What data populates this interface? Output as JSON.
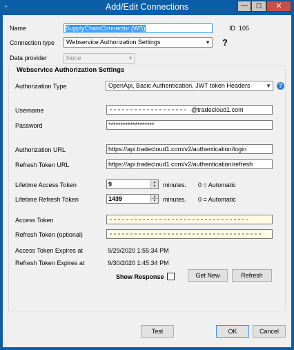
{
  "window": {
    "title": "Add/Edit Connections",
    "buttons": {
      "minimize": "—",
      "maximize": "◻",
      "close": "✕"
    }
  },
  "name_field": {
    "label": "Name",
    "value": "SupplyChainConnector (WS)"
  },
  "id_field": {
    "label": "ID",
    "value": "105"
  },
  "connection_type": {
    "label": "Connection type",
    "value": "Webservice Authorization Settings",
    "help": "?"
  },
  "data_provider": {
    "label": "Data provider",
    "value": "None"
  },
  "group": {
    "title": "Webservice Authorization Settings",
    "authorization_type": {
      "label": "Authorization Type",
      "value": "OpenApi, Basic Authentication, JWT token Headers",
      "help": "?"
    },
    "username": {
      "label": "Username",
      "value": "@tradecloud1.com"
    },
    "password": {
      "label": "Password",
      "value": "*******************"
    },
    "authorization_url": {
      "label": "Authorization URL",
      "value": "https://api.tradecloud1.com/v2/authentication/login"
    },
    "refresh_token_url": {
      "label": "Refresh Token URL",
      "value": "https://api.tradecloud1.com/v2/authentication/refresh"
    },
    "lifetime_access_token": {
      "label": "Lifetime Access Token",
      "value": "9",
      "unit": "minutes.",
      "hint": "0 = Automatic"
    },
    "lifetime_refresh_token": {
      "label": "Lifetime Refresh Token",
      "value": "1439",
      "unit": "minutes.",
      "hint": "0 = Automatic"
    },
    "access_token": {
      "label": "Access Token"
    },
    "refresh_token": {
      "label": "Refresh Token (optional)"
    },
    "access_expires": {
      "label": "Access Token Expires at",
      "value": "9/29/2020 1:55:34 PM"
    },
    "refresh_expires": {
      "label": "Refresh Token Expires at",
      "value": "9/30/2020 1:45:34 PM"
    },
    "show_response": {
      "label": "Show Response",
      "checked": false
    },
    "get_new_label": "Get New",
    "refresh_label": "Refresh"
  },
  "footer": {
    "test_label": "Test",
    "ok_label": "OK",
    "cancel_label": "Cancel"
  }
}
